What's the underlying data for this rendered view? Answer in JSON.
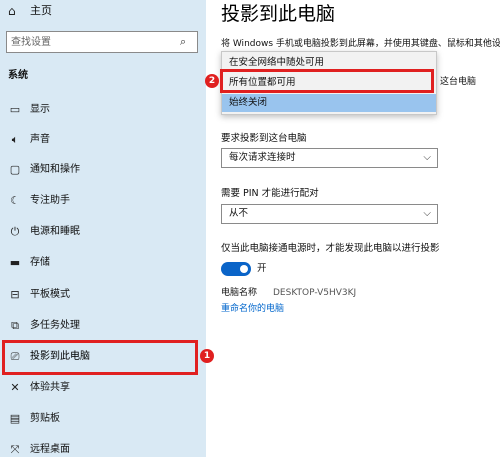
{
  "sidebar": {
    "home_label": "主页",
    "search_placeholder": "查找设置",
    "section_label": "系统",
    "items": [
      {
        "label": "显示",
        "icon": "monitor-icon"
      },
      {
        "label": "声音",
        "icon": "speaker-icon"
      },
      {
        "label": "通知和操作",
        "icon": "notification-icon"
      },
      {
        "label": "专注助手",
        "icon": "moon-icon"
      },
      {
        "label": "电源和睡眠",
        "icon": "power-icon"
      },
      {
        "label": "存储",
        "icon": "storage-icon"
      },
      {
        "label": "平板模式",
        "icon": "tablet-icon"
      },
      {
        "label": "多任务处理",
        "icon": "multitask-icon"
      },
      {
        "label": "投影到此电脑",
        "icon": "project-icon"
      },
      {
        "label": "体验共享",
        "icon": "share-icon"
      },
      {
        "label": "剪贴板",
        "icon": "clipboard-icon"
      },
      {
        "label": "远程桌面",
        "icon": "remote-icon"
      }
    ]
  },
  "main": {
    "title": "投影到此电脑",
    "description": "将 Windows 手机或电脑投影到此屏幕，并使用其键盘、鼠标和其他设",
    "partial_text": "这台电脑",
    "request_label": "要求投影到这台电脑",
    "request_value": "每次请求连接时",
    "pin_label": "需要 PIN 才能进行配对",
    "pin_value": "从不",
    "power_label": "仅当此电脑接通电源时，才能发现此电脑以进行投影",
    "toggle_label": "开",
    "pc_name_label": "电脑名称",
    "pc_name_value": "DESKTOP-V5HV3KJ",
    "rename_link": "重命名你的电脑"
  },
  "dropdown": {
    "options": [
      "在安全网络中随处可用",
      "所有位置都可用",
      "始终关闭"
    ],
    "selected_index": 2
  },
  "annotations": {
    "badge_1": "1",
    "badge_2": "2"
  },
  "colors": {
    "sidebar_bg": "#d9e9f4",
    "accent": "#0a64c8",
    "highlight_red": "#e02020",
    "selected_option": "#99c4ee",
    "link": "#0066cc"
  }
}
